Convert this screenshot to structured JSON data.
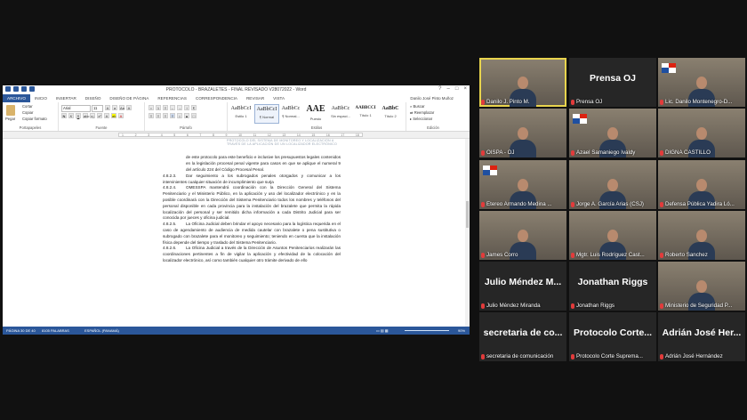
{
  "word": {
    "title": "PROTOCOLO - BRAZALETES - FINAL REVISADO V28072022 - Word",
    "user": "Danilo José Pinto Muñoz",
    "tabs": [
      "ARCHIVO",
      "INICIO",
      "INSERTAR",
      "DISEÑO",
      "DISEÑO DE PÁGINA",
      "REFERENCIAS",
      "CORRESPONDENCIA",
      "REVISAR",
      "VISTA"
    ],
    "ribbon": {
      "paste": "Pegar",
      "cut": "Cortar",
      "copy": "Copiar",
      "format_painter": "Copiar formato",
      "font_name": "Arial",
      "font_size": "11",
      "styles": [
        {
          "preview": "AaBbCcI",
          "name": "Estilo 1"
        },
        {
          "preview": "AaBbCcI",
          "name": "¶ Normal"
        },
        {
          "preview": "AaBbCc",
          "name": "¶ Normal..."
        },
        {
          "preview": "AAE",
          "name": "Puesto"
        },
        {
          "preview": "AaBbCc",
          "name": "Sin espaci..."
        },
        {
          "preview": "AABBCCI",
          "name": "Título 1"
        },
        {
          "preview": "AaBbC",
          "name": "Título 2"
        }
      ],
      "find": "Buscar",
      "replace": "Reemplazar",
      "select": "Seleccionar",
      "groups": [
        "Portapapeles",
        "Fuente",
        "Párrafo",
        "Estilos",
        "Edición"
      ]
    },
    "doc_header": "PROTOCOLO DEL SISTEMA DE MONITOREO Y LOCALIZACIÓN A TRAVÉS DE LA APLICACIÓN DE UN LOCALIZADOR ELECTRÓNICO",
    "paragraphs": [
      {
        "num": "",
        "text": "de este protocolo para este beneficio e inclusive los presupuestos legales contenidos en la legislación procesal penal vigente para casos en que se aplique el numeral 9 del artículo 224 del Código Procesal Penal."
      },
      {
        "num": "4.8.2.3.",
        "text": "Dar seguimiento a los subrogados penales otorgados y comunicar a los intervinientes cualquier situación de incumplimiento que surja"
      },
      {
        "num": "4.8.2.4.",
        "text": "OMESSPA mantendrá coordinación con la Dirección General del Sistema Penitenciario y el Ministerio Público, en la aplicación y uso del localizador electrónico y en la posible coordinará con la Dirección del Sistema Penitenciario todos los nombres y teléfonos del personal disponible en cada provincia para la instalación del brazalete que permita la rápida localización del personal y ser remitido dicha información a cada Distrito Judicial para ser conocida por jueces y oficina judicial."
      },
      {
        "num": "4.8.2.5.",
        "text": "La Oficina Judicial deben brindar el apoyo necesario para la logística requerida en el caso de agendamiento de audiencia de medida cautelar con brazalete o pena sustitutiva o subrogado con brazalete para el monitoreo y seguimiento; teniendo en cuenta que la instalación física depende del tiempo y traslado del Sistema Penitenciario."
      },
      {
        "num": "4.8.2.6.",
        "text": "La Oficina Judicial a través de la Dirección de Asuntos Penitenciarios realizarán las coordinaciones pertinentes a fin de vigilar la aplicación y efectividad de la colocación del localizador electrónico, así como también cualquier otro trámite derivado de ello"
      }
    ],
    "status": {
      "page": "PÁGINA 30 DE 40",
      "words": "8105 PALABRAS",
      "language": "ESPAÑOL (PANAMÁ)",
      "zoom": "90%"
    }
  },
  "participants": [
    {
      "name": "Danilo J. Pinto M.",
      "video": true,
      "active": true
    },
    {
      "name": "Prensa OJ",
      "video": false,
      "big": "Prensa OJ"
    },
    {
      "name": "Lic. Danilo Montenegro-D...",
      "video": true,
      "flag": true
    },
    {
      "name": "OISPA - OJ",
      "video": true
    },
    {
      "name": "Azael Samaniego Ivaldy",
      "video": true,
      "flag": true
    },
    {
      "name": "DIGNA CASTILLO",
      "video": true
    },
    {
      "name": "Etereo Armando Medina ...",
      "video": true,
      "flag": true
    },
    {
      "name": "Jorge A. García Arias (CSJ)",
      "video": true
    },
    {
      "name": "Defensa Pública Yadira Ló...",
      "video": true
    },
    {
      "name": "James Corro",
      "video": true
    },
    {
      "name": "Mgtr. Luis Rodríguez Cast...",
      "video": true
    },
    {
      "name": "Roberto Sanchez",
      "video": true
    },
    {
      "name": "Julio Méndez Miranda",
      "video": false,
      "big": "Julio Méndez M..."
    },
    {
      "name": "Jonathan Riggs",
      "video": false,
      "big": "Jonathan Riggs"
    },
    {
      "name": "Ministerio de Seguridad P...",
      "video": true
    },
    {
      "name": "secretaria de comunicación",
      "video": false,
      "big": "secretaria de co..."
    },
    {
      "name": "Protocolo Corte Suprema...",
      "video": false,
      "big": "Protocolo Corte..."
    },
    {
      "name": "Adrián José Hernández",
      "video": false,
      "big": "Adrián José Her..."
    }
  ]
}
